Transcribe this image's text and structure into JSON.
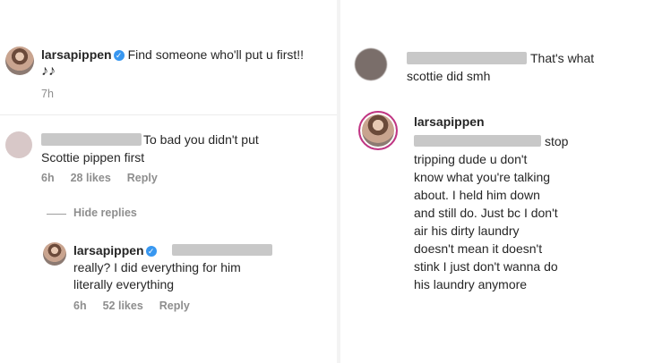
{
  "left": {
    "post": {
      "username": "larsapippen",
      "caption": "Find someone who'll put u first!!",
      "emoji": "♪♪",
      "time": "7h"
    },
    "comment1": {
      "text_line1": "To bad you didn't put",
      "text_line2": "Scottie pippen first",
      "time": "6h",
      "likes": "28 likes",
      "reply": "Reply"
    },
    "hide_replies": "Hide replies",
    "reply1": {
      "username": "larsapippen",
      "line1": "really? I did everything for him",
      "line2": "literally everything",
      "time": "6h",
      "likes": "52 likes",
      "reply": "Reply"
    }
  },
  "right": {
    "comment": {
      "line1": "That's what",
      "line2": "scottie did smh"
    },
    "reply": {
      "username": "larsapippen",
      "lines": [
        "stop",
        "tripping dude u don't",
        "know what you're talking",
        "about. I held him down",
        "and still do. Just bc I don't",
        "air his dirty laundry",
        "doesn't mean it doesn't",
        "stink I just don't wanna do",
        "his laundry anymore"
      ]
    }
  },
  "colors": {
    "verified": "#3897f0",
    "meta_gray": "#8e8e8e",
    "story_ring": "#c13584"
  },
  "icons": {
    "verified": "verified-badge-icon"
  }
}
